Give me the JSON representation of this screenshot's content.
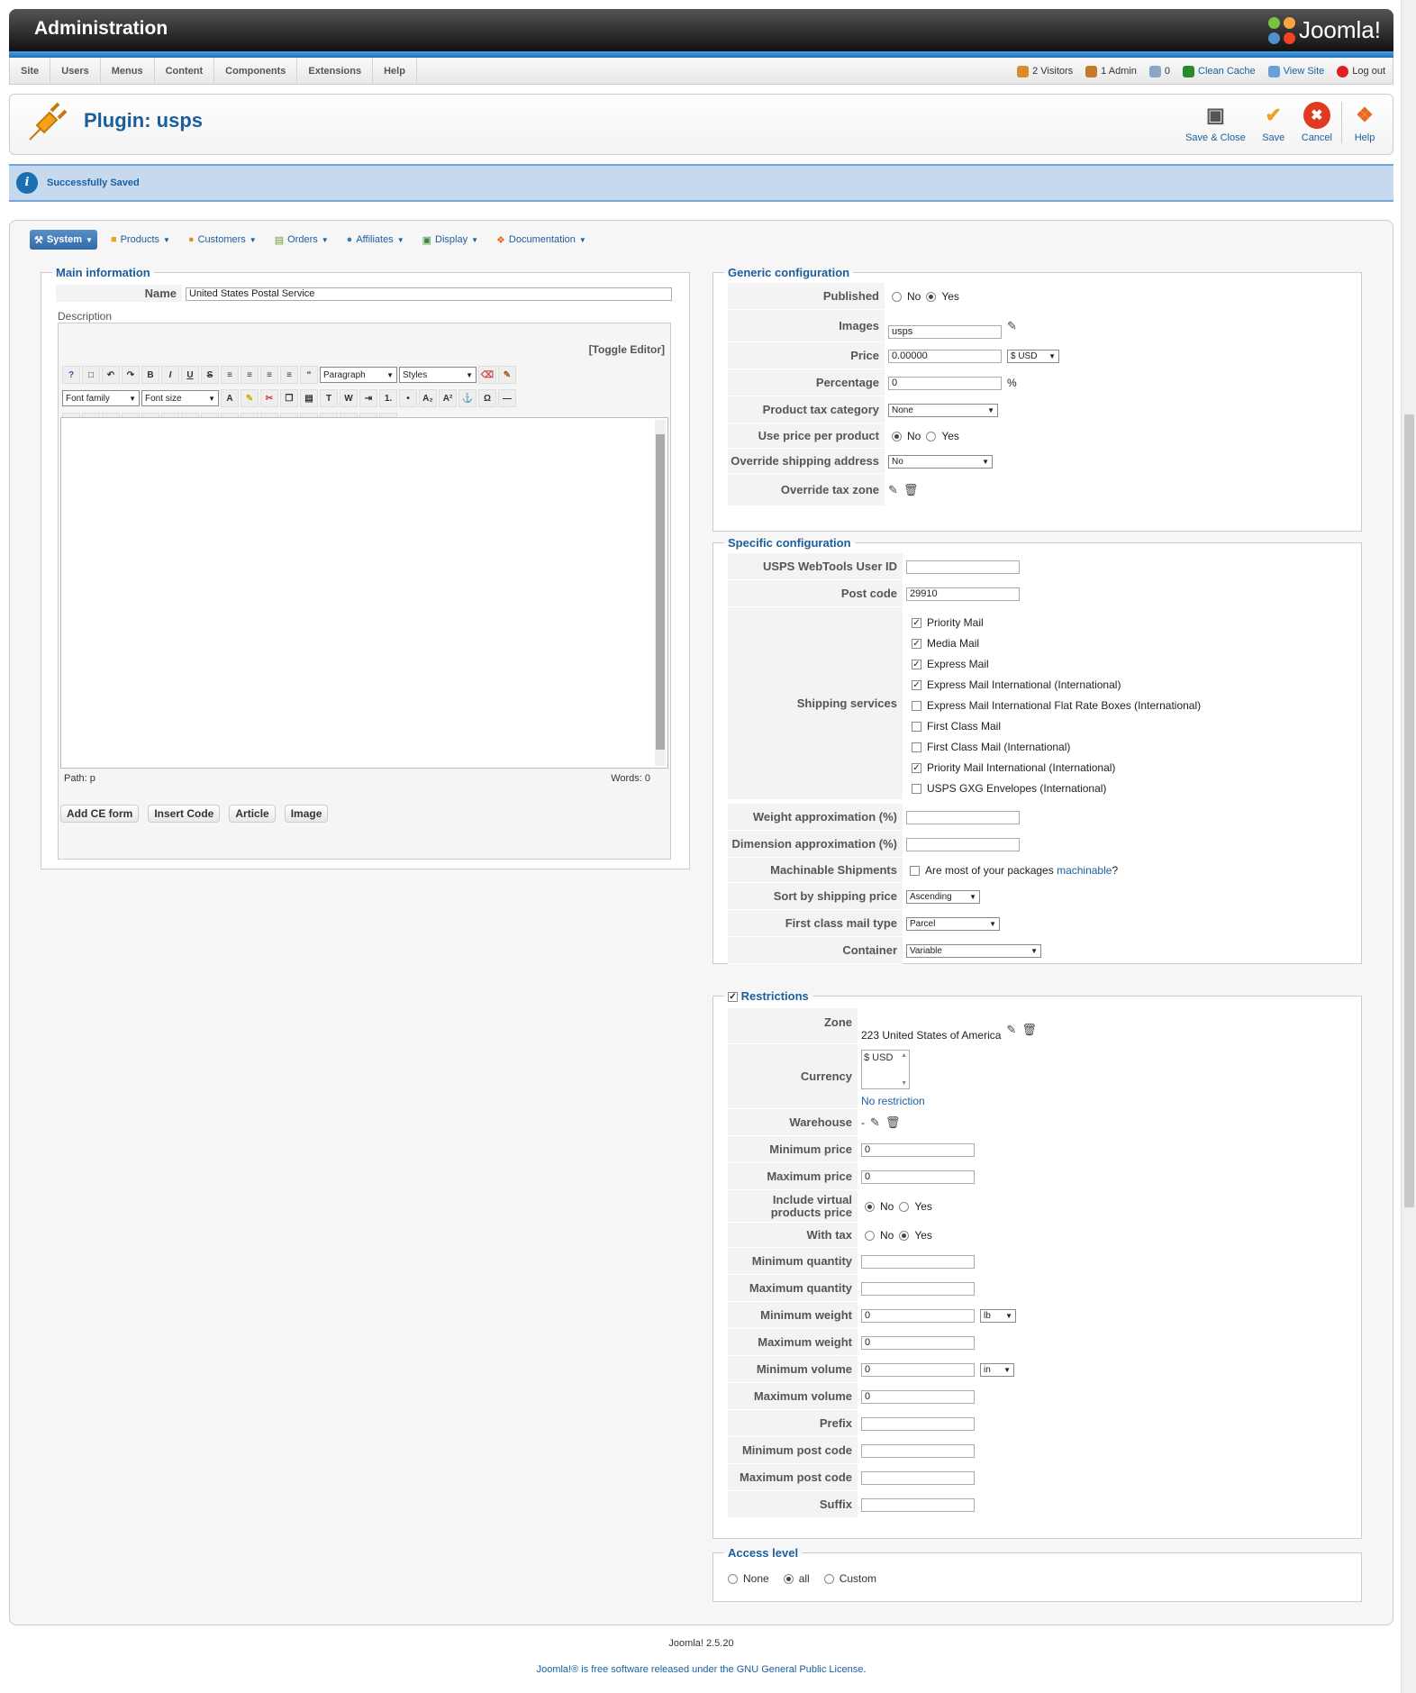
{
  "header": {
    "title": "Administration",
    "logo_text": "Joomla!"
  },
  "menu": [
    "Site",
    "Users",
    "Menus",
    "Content",
    "Components",
    "Extensions",
    "Help"
  ],
  "status": {
    "visitors": "2 Visitors",
    "admins": "1 Admin",
    "messages": "0",
    "clean_cache": "Clean Cache",
    "view_site": "View Site",
    "logout": "Log out"
  },
  "toolbar": {
    "title": "Plugin: usps",
    "save_close": "Save & Close",
    "save": "Save",
    "cancel": "Cancel",
    "help": "Help"
  },
  "message": "Successfully Saved",
  "submenu": [
    "System",
    "Products",
    "Customers",
    "Orders",
    "Affiliates",
    "Display",
    "Documentation"
  ],
  "main_info": {
    "legend": "Main information",
    "name_label": "Name",
    "name_value": "United States Postal Service",
    "description_label": "Description",
    "toggle_editor": "[Toggle Editor]",
    "paragraph": "Paragraph",
    "styles": "Styles",
    "font_family": "Font family",
    "font_size": "Font size",
    "path": "Path:  p",
    "words": "Words: 0",
    "buttons": [
      "Add CE form",
      "Insert Code",
      "Article",
      "Image"
    ]
  },
  "generic": {
    "legend": "Generic configuration",
    "published": "Published",
    "no": "No",
    "yes": "Yes",
    "images": "Images",
    "images_value": "usps",
    "price": "Price",
    "price_value": "0.00000",
    "currency": "$ USD",
    "percentage": "Percentage",
    "percentage_value": "0",
    "percent": "%",
    "product_tax": "Product tax category",
    "product_tax_value": "None",
    "use_price_per_product": "Use price per product",
    "override_shipping": "Override shipping address",
    "override_shipping_value": "No",
    "override_tax_zone": "Override tax zone"
  },
  "specific": {
    "legend": "Specific configuration",
    "user_id": "USPS WebTools User ID",
    "user_id_value": "",
    "post_code": "Post code",
    "post_code_value": "29910",
    "shipping_services": "Shipping services",
    "services": [
      {
        "label": "Priority Mail",
        "checked": true
      },
      {
        "label": "Media Mail",
        "checked": true
      },
      {
        "label": "Express Mail",
        "checked": true
      },
      {
        "label": "Express Mail International (International)",
        "checked": true
      },
      {
        "label": "Express Mail International Flat Rate Boxes (International)",
        "checked": false
      },
      {
        "label": "First Class Mail",
        "checked": false
      },
      {
        "label": "First Class Mail (International)",
        "checked": false
      },
      {
        "label": "Priority Mail International (International)",
        "checked": true
      },
      {
        "label": "USPS GXG Envelopes (International)",
        "checked": false
      }
    ],
    "weight_approx": "Weight approximation (%)",
    "dimension_approx": "Dimension approximation (%)",
    "machinable": "Machinable Shipments",
    "machinable_q": "Are most of your packages ",
    "machinable_link": "machinable",
    "qmark": "?",
    "sort_by": "Sort by shipping price",
    "sort_by_value": "Ascending",
    "first_class_type": "First class mail type",
    "first_class_type_value": "Parcel",
    "container": "Container",
    "container_value": "Variable"
  },
  "restrictions": {
    "legend": "Restrictions",
    "zone": "Zone",
    "zone_value": "223 United States of America",
    "currency": "Currency",
    "currency_value": "$ USD",
    "no_restriction": "No restriction",
    "warehouse": "Warehouse",
    "warehouse_value": "-",
    "min_price": "Minimum price",
    "min_price_value": "0",
    "max_price": "Maximum price",
    "max_price_value": "0",
    "include_virtual": "Include virtual products price",
    "with_tax": "With tax",
    "min_qty": "Minimum quantity",
    "max_qty": "Maximum quantity",
    "min_weight": "Minimum weight",
    "min_weight_value": "0",
    "weight_unit": "lb",
    "max_weight": "Maximum weight",
    "max_weight_value": "0",
    "min_volume": "Minimum volume",
    "min_volume_value": "0",
    "volume_unit": "in",
    "max_volume": "Maximum volume",
    "max_volume_value": "0",
    "prefix": "Prefix",
    "min_post": "Minimum post code",
    "max_post": "Maximum post code",
    "suffix": "Suffix"
  },
  "access": {
    "legend": "Access level",
    "none": "None",
    "all": "all",
    "custom": "Custom"
  },
  "footer": {
    "version": "Joomla! 2.5.20",
    "license_pre": "Joomla!® is free software released under the ",
    "license_link": "GNU General Public License",
    "license_post": "."
  }
}
